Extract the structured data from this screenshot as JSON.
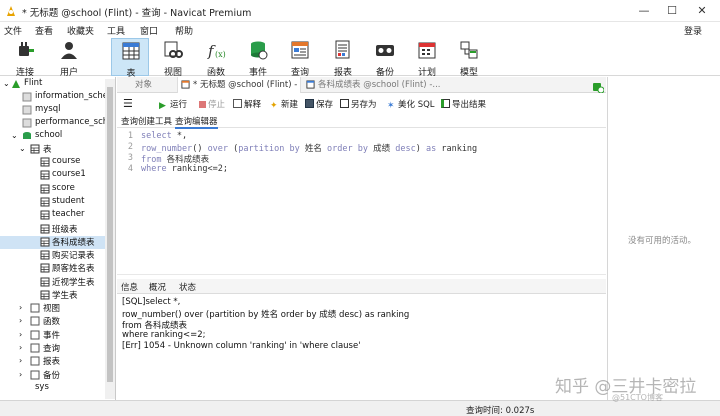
{
  "window": {
    "title": "* 无标题 @school (Flint) - 查询 - Navicat Premium",
    "min": "—",
    "max": "☐",
    "close": "✕"
  },
  "menu": [
    "文件",
    "查看",
    "收藏夹",
    "工具",
    "窗口",
    "帮助"
  ],
  "login_label": "登录",
  "toolbar": [
    {
      "label": "连接",
      "icon": "plug-icon"
    },
    {
      "label": "用户",
      "icon": "user-icon"
    },
    {
      "label": "表",
      "icon": "table-icon",
      "active": true
    },
    {
      "label": "视图",
      "icon": "view-icon"
    },
    {
      "label": "函数",
      "icon": "function-icon"
    },
    {
      "label": "事件",
      "icon": "event-icon"
    },
    {
      "label": "查询",
      "icon": "query-icon"
    },
    {
      "label": "报表",
      "icon": "report-icon"
    },
    {
      "label": "备份",
      "icon": "backup-icon"
    },
    {
      "label": "计划",
      "icon": "schedule-icon"
    },
    {
      "label": "模型",
      "icon": "model-icon"
    }
  ],
  "tree": {
    "root": "Flint",
    "databases": [
      "information_sche",
      "mysql",
      "performance_sche"
    ],
    "school": "school",
    "tables_group": "表",
    "tables": [
      "course",
      "course1",
      "score",
      "student",
      "teacher",
      "班级表",
      "各科成绩表",
      "购买记录表",
      "顾客姓名表",
      "近视学生表",
      "学生表"
    ],
    "selected_table": "各科成绩表",
    "groups": [
      "视图",
      "函数",
      "事件",
      "查询",
      "报表",
      "备份"
    ],
    "last_partial": "sys"
  },
  "tabs": {
    "objects": "对象",
    "query_tab": "* 无标题 @school (Flint) - 查...",
    "table_tab": "各科成绩表 @school (Flint) -..."
  },
  "query_toolbar": {
    "run": "运行",
    "stop": "停止",
    "explain": "解释",
    "new": "新建",
    "save": "保存",
    "save_as": "另存为",
    "beautify": "美化 SQL",
    "export": "导出结果"
  },
  "subtabs": {
    "builder": "查询创建工具",
    "editor": "查询编辑器"
  },
  "sql": {
    "line_numbers": [
      "1",
      "2",
      "3",
      "4"
    ],
    "lines": [
      "select *,",
      "row_number() over (partition by 姓名 order by 成绩 desc) as ranking",
      "from 各科成绩表",
      "where ranking<=2;"
    ]
  },
  "result_tabs": [
    "信息",
    "概况",
    "状态"
  ],
  "messages": [
    "[SQL]select *,",
    "row_number() over (partition by 姓名 order by 成绩 desc) as ranking",
    "from 各科成绩表",
    "where ranking<=2;",
    "[Err] 1054 - Unknown column 'ranking' in 'where clause'"
  ],
  "right_panel_hint": "没有可用的活动。",
  "status": "查询时间: 0.027s",
  "watermark": "知乎 @三井卡密拉",
  "watermark_small": "@51CTO博客",
  "colors": {
    "active_tab_bg": "#cde6f7",
    "selection": "#cfe3f5",
    "keyword": "#7f7fb8"
  }
}
